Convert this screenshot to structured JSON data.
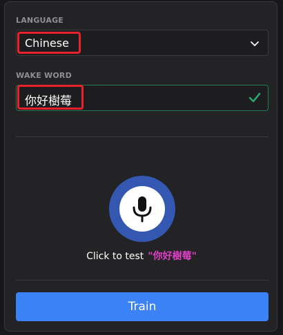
{
  "language": {
    "label": "LANGUAGE",
    "value": "Chinese",
    "icon": "chevron-down-icon"
  },
  "wake_word": {
    "label": "WAKE WORD",
    "value": "你好樹莓",
    "status_icon": "check-icon",
    "valid": true
  },
  "test": {
    "prompt": "Click to test",
    "phrase": "\"你好樹莓\"",
    "icon": "microphone-icon"
  },
  "actions": {
    "train_label": "Train"
  },
  "colors": {
    "accent": "#3b82f6",
    "mic_ring": "#3457b2",
    "valid": "#1f7a54",
    "phrase": "#e040c8",
    "highlight": "#e8212d"
  }
}
